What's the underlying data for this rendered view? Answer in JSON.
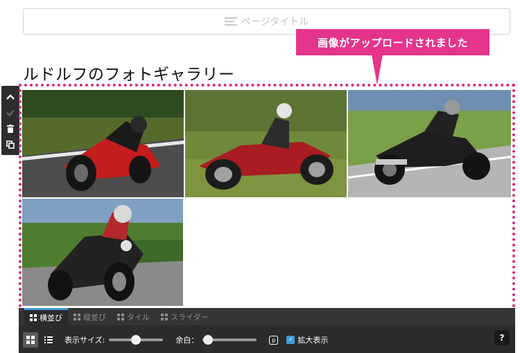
{
  "page_title_placeholder": "ページタイトル",
  "callout_text": "画像がアップロードされました",
  "gallery_heading": "ルドルフのフォトギャラリー",
  "side_toolbar": {
    "icons": [
      "chevron-up-icon",
      "check-icon",
      "trash-icon",
      "duplicate-icon"
    ]
  },
  "photos": [
    {
      "name": "red-sport-motorcycle-photo",
      "description_colors": [
        "#cc1f1f",
        "#6a7a3a",
        "#4a4a4a"
      ]
    },
    {
      "name": "red-adventure-motorcycle-photo",
      "description_colors": [
        "#b81d24",
        "#7c8a3a",
        "#c8c8c8"
      ]
    },
    {
      "name": "black-naked-motorcycle-photo",
      "description_colors": [
        "#1e1e1e",
        "#7aa04a",
        "#b8b8b8"
      ]
    },
    {
      "name": "black-cruiser-motorcycle-photo",
      "description_colors": [
        "#222222",
        "#4f7d2f",
        "#8a8a8a"
      ]
    }
  ],
  "bottom_bar": {
    "tabs": [
      {
        "label": "横並び",
        "active": true
      },
      {
        "label": "縦並び",
        "active": false
      },
      {
        "label": "タイル",
        "active": false
      },
      {
        "label": "スライダー",
        "active": false
      }
    ],
    "display_size_label": "表示サイズ:",
    "display_size_value": 0.5,
    "margin_label": "余白：",
    "margin_value": 0.1,
    "zoom_label": "拡大表示",
    "zoom_checked": true,
    "help_label": "?"
  },
  "colors": {
    "accent_pink": "#e4348b",
    "tab_active_blue": "#3d9ad8",
    "toolbar_dark": "#2b2b2b"
  }
}
